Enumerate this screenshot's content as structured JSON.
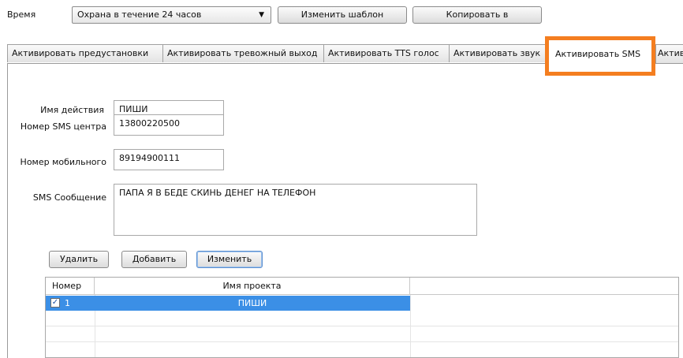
{
  "top_bar": {
    "time_label": "Время",
    "schedule_value": "Охрана в течение 24 часов",
    "edit_template_label": "Изменить шаблон",
    "copy_to_label": "Копировать в"
  },
  "tabs": [
    {
      "label": "Активировать предустановки"
    },
    {
      "label": "Активировать тревожный выход"
    },
    {
      "label": "Активировать TTS голос"
    },
    {
      "label": "Активировать звук"
    },
    {
      "label": "Активировать SMS",
      "active": true
    },
    {
      "label": "Активи"
    }
  ],
  "form": {
    "action_name_label": "Имя действия",
    "action_name_value": "ПИШИ",
    "sms_center_label": "Номер SMS центра",
    "sms_center_value": "13800220500",
    "mobile_label": "Номер мобильного",
    "mobile_value": "89194900111",
    "sms_message_label": "SMS Сообщение",
    "sms_message_value": "ПАПА Я В БЕДЕ СКИНЬ ДЕНЕГ НА ТЕЛЕФОН"
  },
  "actions": {
    "delete_label": "Удалить",
    "add_label": "Добавить",
    "change_label": "Изменить"
  },
  "table": {
    "columns": [
      "Номер",
      "Имя проекта"
    ],
    "rows": [
      {
        "checked": true,
        "checkmark": "✓",
        "number": "1",
        "project_name": "ПИШИ"
      }
    ]
  },
  "colors": {
    "highlight_border": "#f47e20",
    "selected_row": "#3b8fe6"
  }
}
